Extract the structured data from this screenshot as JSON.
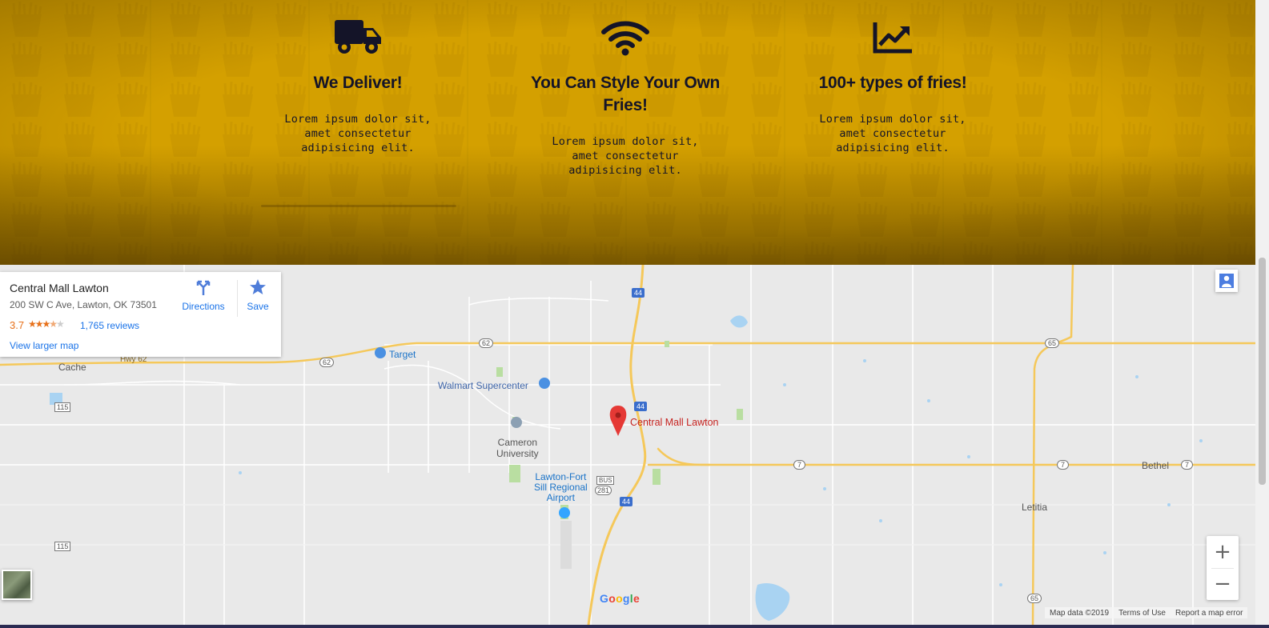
{
  "features": [
    {
      "icon": "truck-icon",
      "title": "We Deliver!",
      "title_lines": [
        "We Deliver!"
      ],
      "text_lines": [
        "Lorem ipsum dolor sit,",
        "amet consectetur",
        "adipisicing elit."
      ]
    },
    {
      "icon": "wifi-icon",
      "title": "You Can Style Your Own Fries!",
      "title_lines": [
        "You Can Style Your Own",
        "Fries!"
      ],
      "text_lines": [
        "Lorem ipsum dolor sit,",
        "amet consectetur",
        "adipisicing elit."
      ]
    },
    {
      "icon": "chart-line-icon",
      "title": "100+ types of fries!",
      "title_lines": [
        "100+ types of fries!"
      ],
      "text_lines": [
        "Lorem ipsum dolor sit,",
        "amet consectetur",
        "adipisicing elit."
      ]
    }
  ],
  "map": {
    "card": {
      "name": "Central Mall Lawton",
      "address": "200 SW C Ave, Lawton, OK 73501",
      "rating": "3.7",
      "rating_value": 3.7,
      "reviews": "1,765 reviews",
      "view_larger": "View larger map",
      "directions": "Directions",
      "save": "Save"
    },
    "places": {
      "target": "Target",
      "walmart": "Walmart Supercenter",
      "cache": "Cache",
      "cameron1": "Cameron",
      "cameron2": "University",
      "airport1": "Lawton-Fort",
      "airport2": "Sill Regional",
      "airport3": "Airport",
      "mall": "Central Mall Lawton",
      "bethel": "Bethel",
      "letitia": "Letitia",
      "hwy62": "Hwy 62"
    },
    "shields": {
      "i44a": "44",
      "i44b": "44",
      "i44c": "44",
      "us62a": "62",
      "us62b": "62",
      "ok115a": "115",
      "ok115b": "115",
      "ok7a": "7",
      "ok7b": "7",
      "ok7c": "7",
      "ok65a": "65",
      "ok65b": "65",
      "bus": "BUS",
      "us281": "281"
    },
    "zoom_in": "+",
    "zoom_out": "−",
    "google": [
      "G",
      "o",
      "o",
      "g",
      "l",
      "e"
    ],
    "google_colors": [
      "#4285F4",
      "#EA4335",
      "#FBBC05",
      "#4285F4",
      "#34A853",
      "#EA4335"
    ],
    "footer": {
      "data": "Map data ©2019",
      "terms": "Terms of Use",
      "report": "Report a map error"
    }
  },
  "colors": {
    "band": "#d4a000",
    "ink": "#141428",
    "link": "#1a73e8",
    "rating": "#e7711b",
    "pin": "#e53935"
  }
}
